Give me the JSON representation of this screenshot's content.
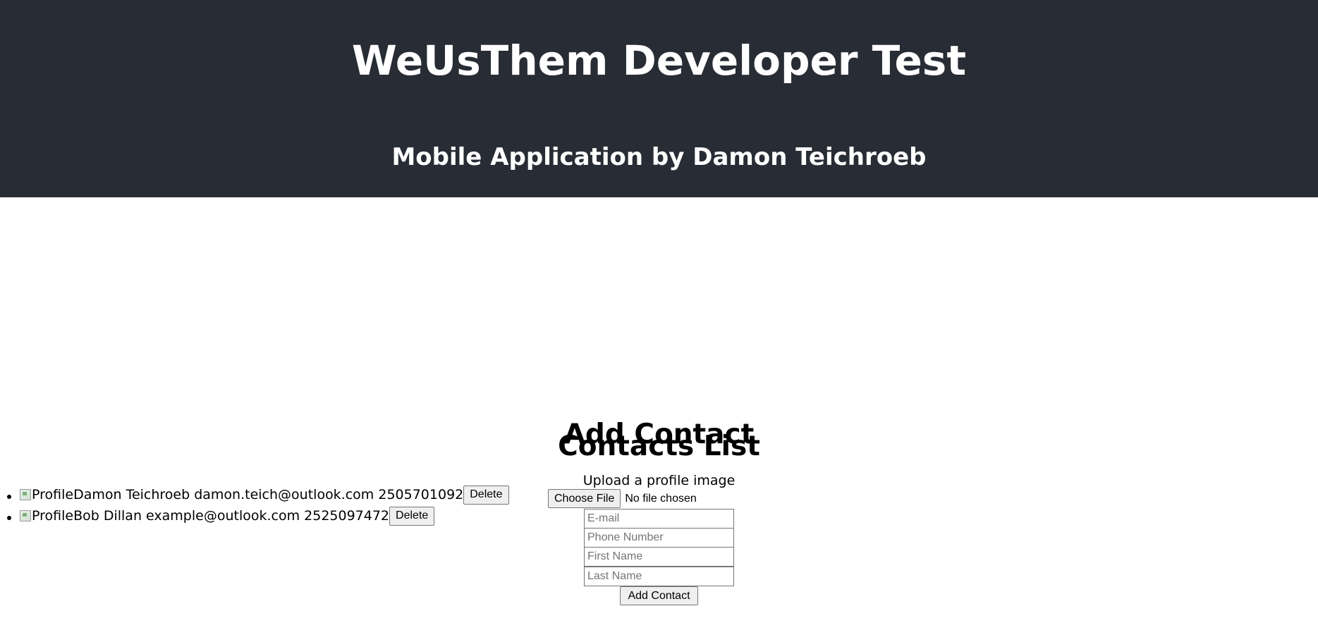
{
  "header": {
    "title": "WeUsThem Developer Test",
    "subtitle": "Mobile Application by Damon Teichroeb"
  },
  "add_contact": {
    "heading": "Add Contact",
    "upload_label": "Upload a profile image",
    "choose_file_label": "Choose File",
    "file_status": "No file chosen",
    "email_placeholder": "E-mail",
    "phone_placeholder": "Phone Number",
    "first_name_placeholder": "First Name",
    "last_name_placeholder": "Last Name",
    "submit_label": "Add Contact"
  },
  "contacts_list": {
    "heading": "Contacts List",
    "items": [
      {
        "image_alt": "Profile",
        "name": "Damon Teichroeb",
        "email": "damon.teich@outlook.com",
        "phone": "2505701092",
        "delete_label": "Delete"
      },
      {
        "image_alt": "Profile",
        "name": "Bob Dillan",
        "email": "example@outlook.com",
        "phone": "2525097472",
        "delete_label": "Delete"
      }
    ]
  }
}
